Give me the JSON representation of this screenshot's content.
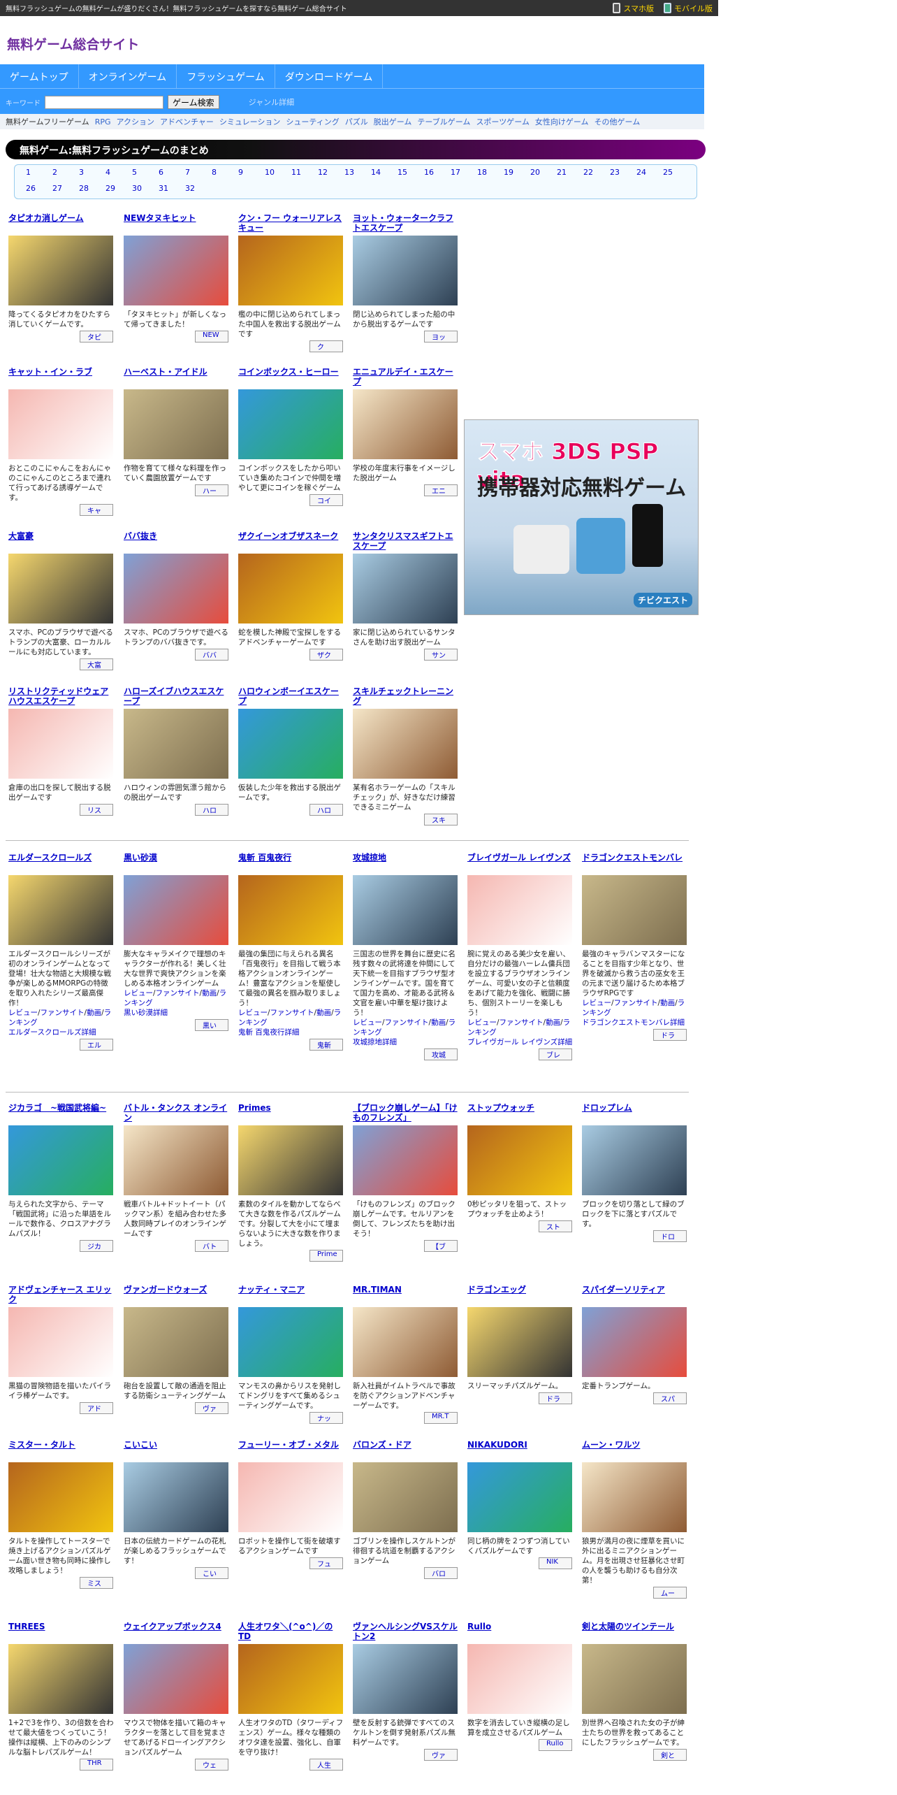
{
  "topbar": {
    "tagline": "無料フラッシュゲームの無料ゲームが盛りだくさん！無料フラッシュゲームを探すなら無料ゲーム総合サイト",
    "smartphone": "スマホ版",
    "mobile": "モバイル版"
  },
  "site": {
    "logo": "無料ゲーム総合サイト"
  },
  "nav": {
    "items": [
      "ゲームトップ",
      "オンラインゲーム",
      "フラッシュゲーム",
      "ダウンロードゲーム"
    ],
    "keyword_label": "キーワード",
    "search_button": "ゲーム検索",
    "genre_link": "ジャンル詳細"
  },
  "catbar": {
    "label": "無料ゲームフリーゲーム",
    "items": [
      "RPG",
      "アクション",
      "アドベンチャー",
      "シミュレーション",
      "シューティング",
      "パズル",
      "脱出ゲーム",
      "テーブルゲーム",
      "スポーツゲーム",
      "女性向けゲーム",
      "その他ゲーム"
    ]
  },
  "section": {
    "title": "無料ゲーム:無料フラッシュゲームのまとめ"
  },
  "pager": [
    "1",
    "2",
    "3",
    "4",
    "5",
    "6",
    "7",
    "8",
    "9",
    "10",
    "11",
    "12",
    "13",
    "14",
    "15",
    "16",
    "17",
    "18",
    "19",
    "20",
    "21",
    "22",
    "23",
    "24",
    "25",
    "26",
    "27",
    "28",
    "29",
    "30",
    "31",
    "32"
  ],
  "ad": {
    "line1": "スマホ 3DS PSP vita",
    "line2": "携帯器対応無料ゲーム",
    "brand": "チビクエスト"
  },
  "common": {
    "review": "レビュー",
    "fansite": "ファンサイト",
    "video": "動画",
    "ranking": "ランキング"
  },
  "flash_rows": [
    [
      {
        "title": "タピオカ消しゲーム",
        "desc": "降ってくるタピオカをひたすら消していくゲームです。",
        "btn": "タピ"
      },
      {
        "title": "NEWタヌキヒット",
        "desc": "「タヌキヒット」が新しくなって帰ってきました！",
        "btn": "NEW"
      },
      {
        "title": "クン・フー ウォーリアレスキュー",
        "desc": "檻の中に閉じ込められてしまった中国人を救出する脱出ゲームです",
        "btn": "ク"
      },
      {
        "title": "ヨット・ウォータークラフトエスケープ",
        "desc": "閉じ込められてしまった船の中から脱出するゲームです",
        "btn": "ヨッ"
      }
    ],
    [
      {
        "title": "キャット・イン・ラブ",
        "desc": "おとこのこにゃんこをおんにゃのこにゃんこのところまで連れて行ってあげる誘導ゲームです。",
        "btn": "キャ"
      },
      {
        "title": "ハーベスト・アイドル",
        "desc": "作物を育てて様々な料理を作っていく農園放置ゲームです",
        "btn": "ハー"
      },
      {
        "title": "コインボックス・ヒーロー",
        "desc": "コインボックスをしたから叩いていき集めたコインで仲間を増やして更にコインを稼ぐゲーム",
        "btn": "コイ"
      },
      {
        "title": "エニュアルデイ・エスケープ",
        "desc": "学校の年度末行事をイメージした脱出ゲーム",
        "btn": "エニ"
      }
    ],
    [
      {
        "title": "大富豪",
        "desc": "スマホ、PCのブラウザで遊べるトランプの大富豪、ローカルルールにも対応しています。",
        "btn": "大富"
      },
      {
        "title": "ババ抜き",
        "desc": "スマホ、PCのブラウザで遊べるトランプのババ抜きです。",
        "btn": "ババ"
      },
      {
        "title": "ザクイーンオブザスネーク",
        "desc": "蛇を模した神殿で宝探しをするアドベンチャーゲームです",
        "btn": "ザク"
      },
      {
        "title": "サンタクリスマスギフトエスケープ",
        "desc": "家に閉じ込められているサンタさんを助け出す脱出ゲーム",
        "btn": "サン"
      }
    ],
    [
      {
        "title": "リストリクティッドウェアハウスエスケープ",
        "desc": "倉庫の出口を探して脱出する脱出ゲームです",
        "btn": "リス"
      },
      {
        "title": "ハローズイブハウスエスケープ",
        "desc": "ハロウィンの雰囲気漂う館からの脱出ゲームです",
        "btn": "ハロ"
      },
      {
        "title": "ハロウィンボーイエスケープ",
        "desc": "仮装した少年を救出する脱出ゲームです。",
        "btn": "ハロ"
      },
      {
        "title": "スキルチェックトレーニング",
        "desc": "某有名ホラーゲームの「スキルチェック」が、好きなだけ練習できるミニゲーム",
        "btn": "スキ"
      }
    ]
  ],
  "online_row": [
    {
      "title": "エルダースクロールズ",
      "desc": "エルダースクロールシリーズが初のオンラインゲームとなって登場！壮大な物語と大規模な戦争が楽しめるMMORPGの特徴を取り入れたシリーズ最高傑作！",
      "detail": "エルダースクロールズ詳細",
      "btn": "エル"
    },
    {
      "title": "黒い砂漠",
      "desc": "膨大なキャラメイクで理想のキャラクターが作れる！美しく壮大な世界で爽快アクションを楽しめる本格オンラインゲーム",
      "detail": "黒い砂漠詳細",
      "btn": "黒い"
    },
    {
      "title": "鬼斬 百鬼夜行",
      "desc": "最強の集団に与えられる異名「百鬼夜行」を目指して戦う本格アクションオンラインゲーム！豊富なアクションを駆使して最強の異名を掴み取りましょう！",
      "detail": "鬼斬 百鬼夜行詳細",
      "btn": "鬼斬"
    },
    {
      "title": "攻城掠地",
      "desc": "三国志の世界を舞台に歴史に名残す数々の武将達を仲間にして天下統一を目指すブラウザ型オンラインゲームです。国を育てて国力を高め、才能ある武将＆文官を雇い中華を駆け抜けよう！",
      "detail": "攻城掠地詳細",
      "btn": "攻城"
    },
    {
      "title": "ブレイヴガール レイヴンズ",
      "desc": "腕に覚えのある美少女を雇い、自分だけの最強ハーレム傭兵団を設立するブラウザオンラインゲーム、可愛い女の子と信頼度をあげて能力を強化、戦闘に勝ち、個別ストーリーを楽しもう！",
      "detail": "ブレイヴガール レイヴンズ詳細",
      "btn": "ブレ"
    },
    {
      "title": "ドラゴンクエストモンバレ",
      "desc": "最強のキャラバンマスターになることを目指す少年となり、世界を破滅から救う古の巫女を王の元まで送り届けるため本格ブラウザRPGです",
      "detail": "ドラゴンクエストモンバレ詳細",
      "btn": "ドラ"
    }
  ],
  "flash6_rows": [
    [
      {
        "title": "ジカラゴ　~戦国武将編~",
        "desc": "与えられた文字から、テーマ「戦国武将」に沿った単語をルールで数作る、クロスアナグラムパズル！",
        "btn": "ジカ"
      },
      {
        "title": "バトル・タンクス オンライン",
        "desc": "戦車バトル+ドットイート（パックマン系）を組み合わせた多人数同時プレイのオンラインゲームです",
        "btn": "バト"
      },
      {
        "title": "Primes",
        "desc": "素数のタイルを動かしてならべて大きな数を作るパズルゲームです。分裂して大を小にて埋まらないように大きな数を作りましょう。",
        "btn": "Prime"
      },
      {
        "title": "【ブロック崩しゲーム】「けものフレンズ」",
        "desc": "「けものフレンズ」のブロック崩しゲームです。セルリアンを倒して、フレンズたちを助け出そう！",
        "btn": "【ブ"
      },
      {
        "title": "ストップウォッチ",
        "desc": "0秒ピッタリを狙って、ストップウォッチを止めよう！",
        "btn": "スト"
      },
      {
        "title": "ドロップレム",
        "desc": "ブロックを切り落として緑のブロックを下に落とすパズルです。",
        "btn": "ドロ"
      }
    ],
    [
      {
        "title": "アドヴェンチャース エリック",
        "desc": "黒猫の冒険物語を描いたパイライラ棒ゲームです。",
        "btn": "アド"
      },
      {
        "title": "ヴァンガードウォーズ",
        "desc": "砲台を設置して敵の通過を阻止する防衛シューティングゲーム",
        "btn": "ヴァ"
      },
      {
        "title": "ナッティ・マニア",
        "desc": "マンモスの鼻からリスを発射してドングリをすべて集めるシューティングゲームです。",
        "btn": "ナッ"
      },
      {
        "title": "MR.TIMAN",
        "desc": "新入社員がイムトラベルで事故を防ぐアクションアドベンチャーゲームです。",
        "btn": "MR.T"
      },
      {
        "title": "ドラゴンエッグ",
        "desc": "スリーマッチパズルゲーム。",
        "btn": "ドラ"
      },
      {
        "title": "スパイダーソリティア",
        "desc": "定番トランプゲーム。",
        "btn": "スパ"
      }
    ],
    [
      {
        "title": "ミスター・タルト",
        "desc": "タルトを操作してトースターで焼き上げるアクションパズルゲーム面い世き物も同時に操作し攻略しましょう！",
        "btn": "ミス"
      },
      {
        "title": "こいこい",
        "desc": "日本の伝統カードゲームの花札が楽しめるフラッシュゲームです！",
        "btn": "こい"
      },
      {
        "title": "フューリー・オブ・メタル",
        "desc": "ロボットを操作して街を破壊するアクションゲームです",
        "btn": "フュ"
      },
      {
        "title": "バロンズ・ドア",
        "desc": "ゴブリンを操作しスケルトンが徘徊する坑道を制覇するアクションゲーム",
        "btn": "バロ"
      },
      {
        "title": "NIKAKUDORI",
        "desc": "同じ柄の牌を２つずつ消していくパズルゲームです",
        "btn": "NIK"
      },
      {
        "title": "ムーン・ワルツ",
        "desc": "狼男が満月の夜に煙草を買いに外に出るミニアクションゲーム。月を出現させ狂暴化させ町の人を襲うも助けるも自分次第！",
        "btn": "ムー"
      }
    ],
    [
      {
        "title": "THREES",
        "desc": "1+2で3を作り、3の倍数を合わせて最大値をつくっていこう！操作は縦横、上下のみのシンプルな脳トレパズルゲーム！",
        "btn": "THR"
      },
      {
        "title": "ウェイクアップボックス4",
        "desc": "マウスで物体を描いて箱のキャラクターを落として目を覚まさせてあげるドローイングアクションパズルゲーム",
        "btn": "ウェ"
      },
      {
        "title": "人生オワタ＼(^o^)／のTD",
        "desc": "人生オワタのTD（タワーディフェンス）ゲーム。様々な種類のオワタ達を設置、強化し、自軍を守り抜け！",
        "btn": "人生"
      },
      {
        "title": "ヴァンヘルシングVSスケルトン2",
        "desc": "壁を反射する銃弾ですべてのスケルトンを倒す発射系パズル無料ゲームです。",
        "btn": "ヴァ"
      },
      {
        "title": "Rullo",
        "desc": "数字を消去していき縦横の足し算を成立させるパズルゲーム",
        "btn": "Rullo"
      },
      {
        "title": "剣と太陽のツインテール",
        "desc": "別世界へ召喚された女の子が紳士たちの世界を救ってあることにしたフラッシュゲームです。",
        "btn": "剣と"
      }
    ]
  ],
  "colors": {
    "nav": "#3399ff",
    "logo": "#7030a0",
    "link": "#0000cc"
  }
}
